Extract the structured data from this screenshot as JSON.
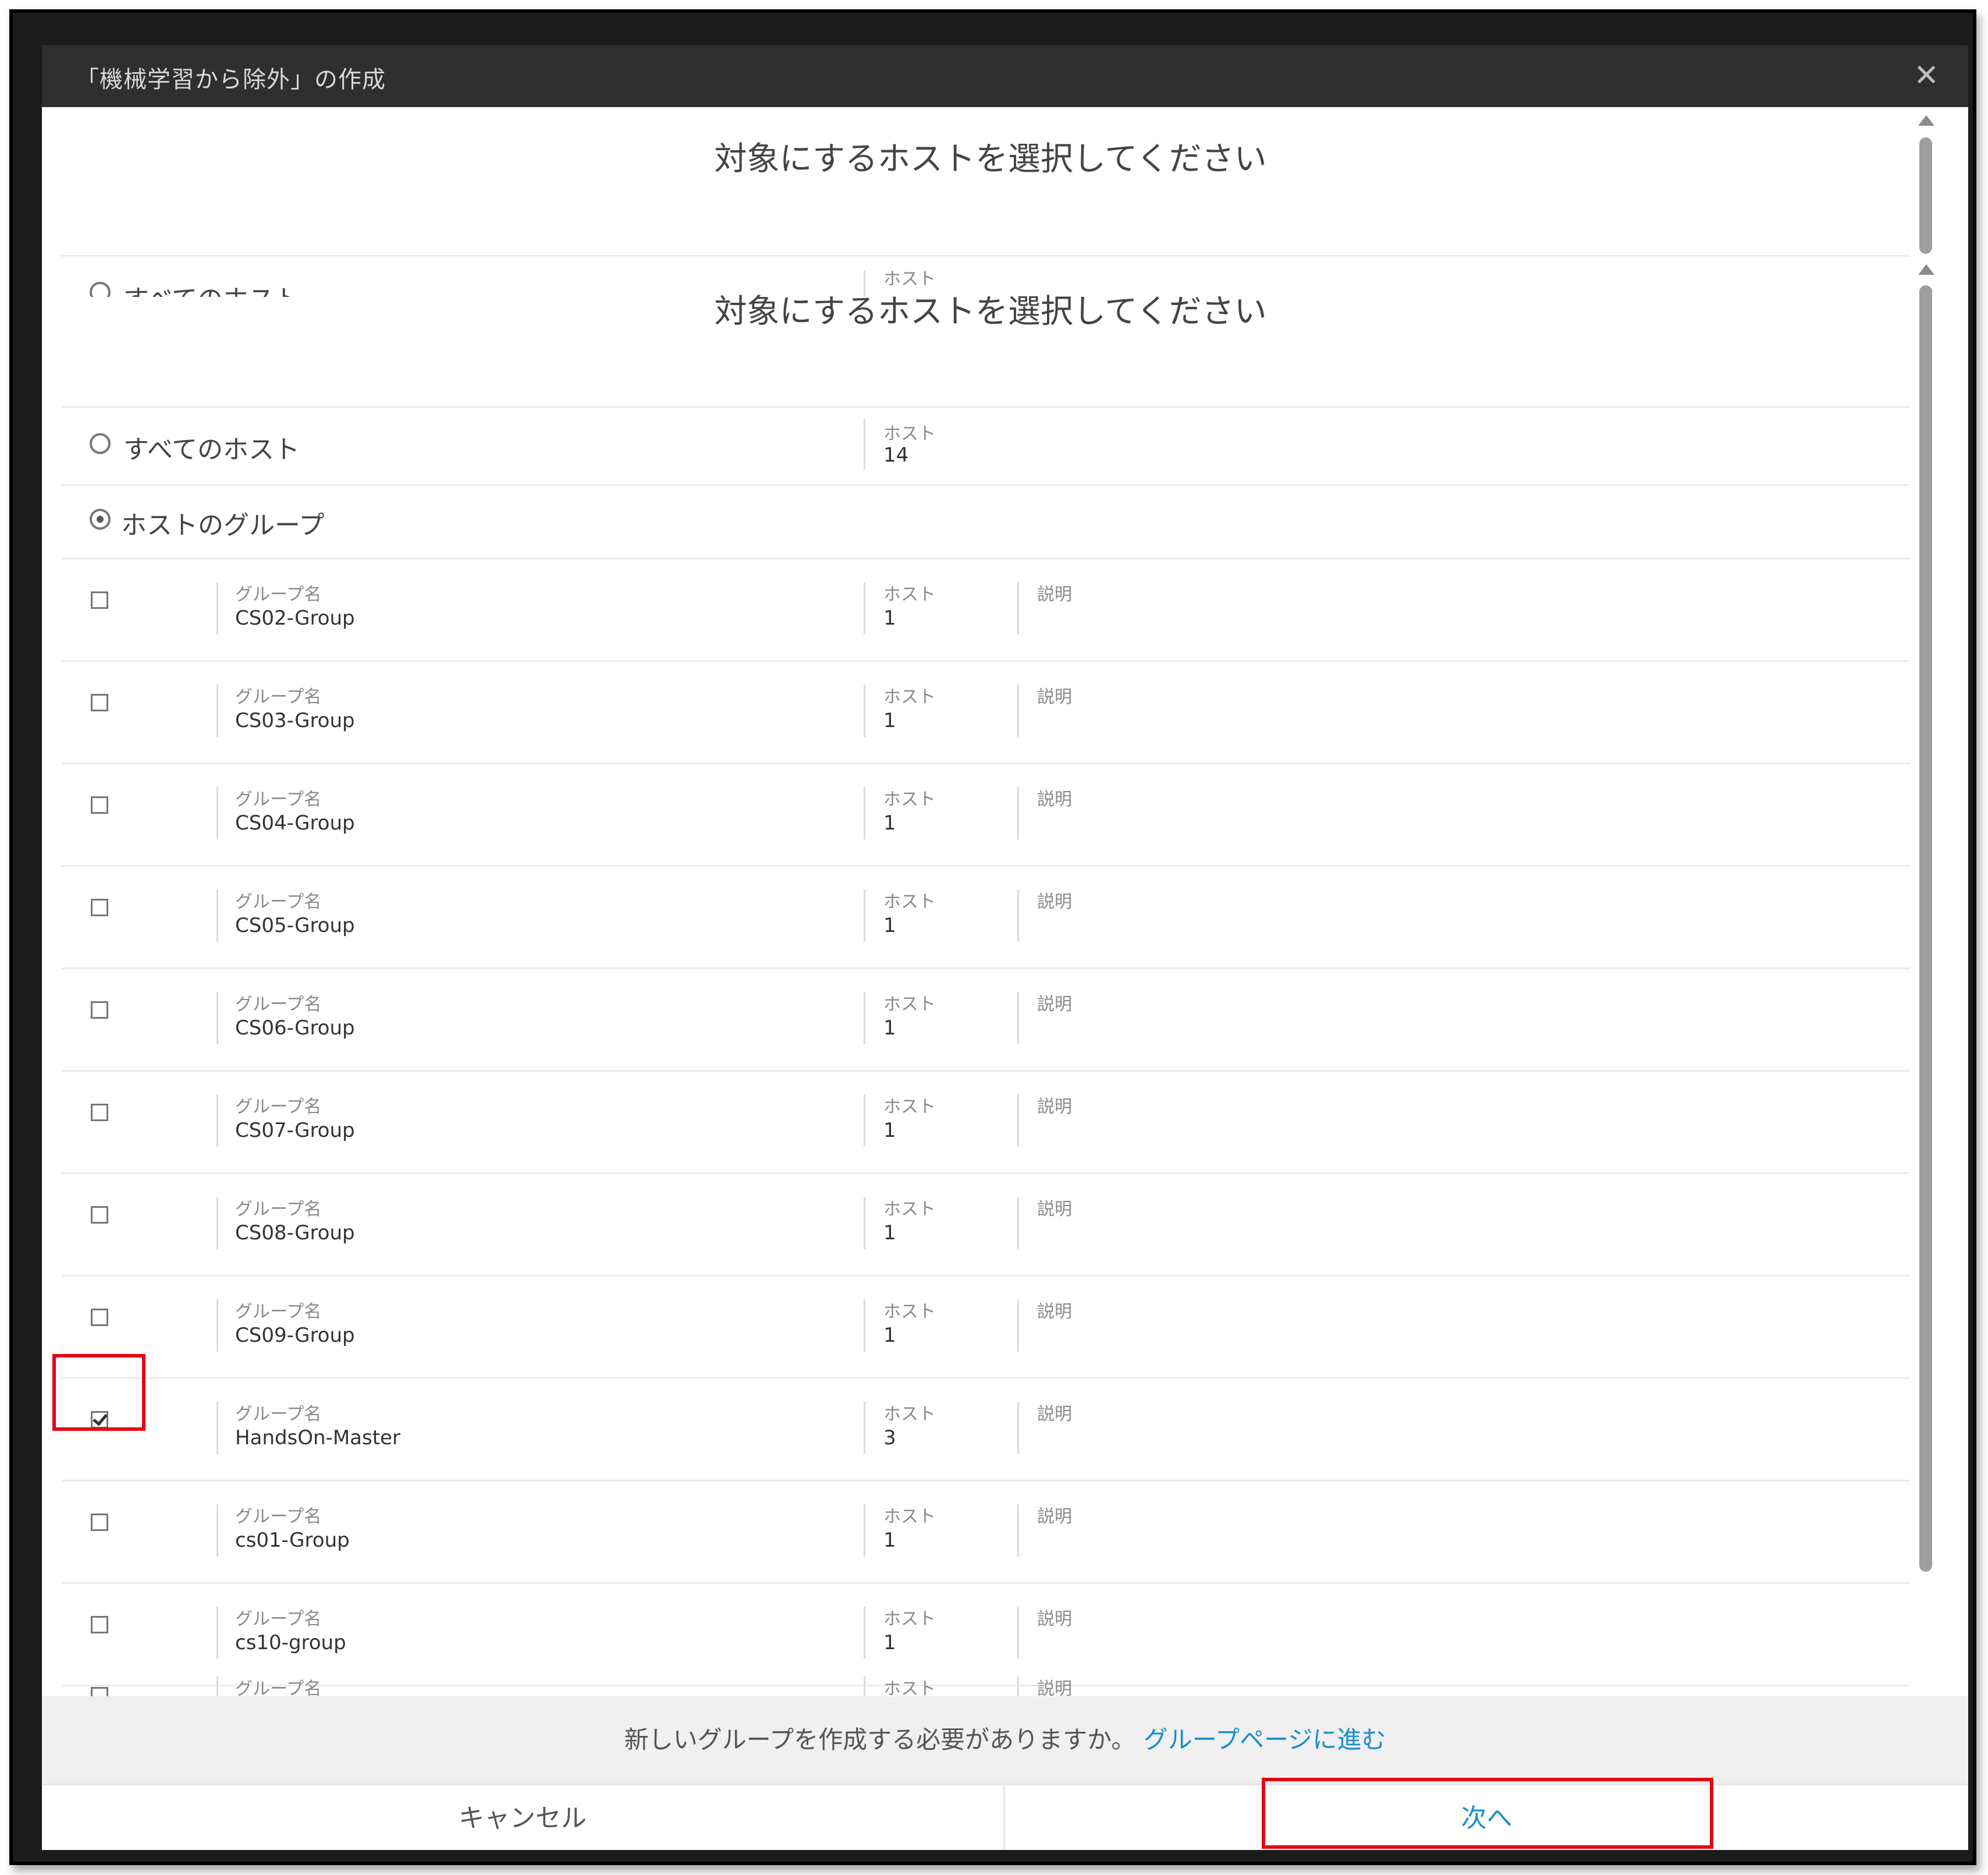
{
  "dialog": {
    "title": "「機械学習から除外」の作成",
    "close_glyph": "✕"
  },
  "top": {
    "heading": "対象にするホストを選択してください",
    "all_hosts_label": "すべてのホスト",
    "host_caption": "ホスト"
  },
  "main": {
    "heading": "対象にするホストを選択してください",
    "all_hosts": {
      "label": "すべてのホスト",
      "caption": "ホスト",
      "count": "14"
    },
    "groups_option": {
      "label": "ホストのグループ"
    },
    "captions": {
      "group_name": "グループ名",
      "hosts": "ホスト",
      "description": "説明"
    },
    "groups": [
      {
        "name": "CS02-Group",
        "hosts": "1",
        "checked": false
      },
      {
        "name": "CS03-Group",
        "hosts": "1",
        "checked": false
      },
      {
        "name": "CS04-Group",
        "hosts": "1",
        "checked": false
      },
      {
        "name": "CS05-Group",
        "hosts": "1",
        "checked": false
      },
      {
        "name": "CS06-Group",
        "hosts": "1",
        "checked": false
      },
      {
        "name": "CS07-Group",
        "hosts": "1",
        "checked": false
      },
      {
        "name": "CS08-Group",
        "hosts": "1",
        "checked": false
      },
      {
        "name": "CS09-Group",
        "hosts": "1",
        "checked": false
      },
      {
        "name": "HandsOn-Master",
        "hosts": "3",
        "checked": true
      },
      {
        "name": "cs01-Group",
        "hosts": "1",
        "checked": false
      },
      {
        "name": "cs10-group",
        "hosts": "1",
        "checked": false
      }
    ]
  },
  "footer": {
    "question": "新しいグループを作成する必要がありますか。",
    "link": "グループページに進む",
    "cancel": "キャンセル",
    "next": "次へ"
  },
  "colors": {
    "accent": "#1a8fc9",
    "highlight": "#e60012",
    "titlebar": "#2f2f2f"
  }
}
